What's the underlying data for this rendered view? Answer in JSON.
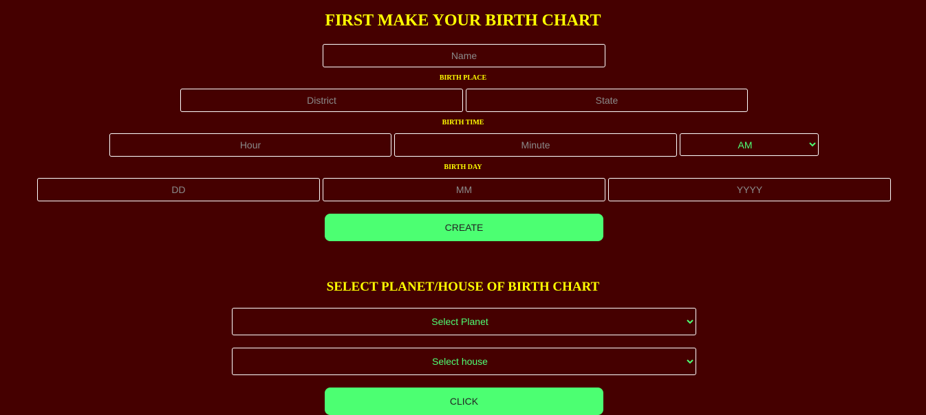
{
  "birth_chart_form": {
    "title": "FIRST MAKE YOUR BIRTH CHART",
    "name_placeholder": "Name",
    "birth_place_label": "BIRTH PLACE",
    "district_placeholder": "District",
    "state_placeholder": "State",
    "birth_time_label": "BIRTH TIME",
    "hour_placeholder": "Hour",
    "minute_placeholder": "Minute",
    "ampm_selected": "AM",
    "birth_day_label": "BIRTH DAY",
    "dd_placeholder": "DD",
    "mm_placeholder": "MM",
    "yyyy_placeholder": "YYYY",
    "create_label": "CREATE"
  },
  "planet_house_section": {
    "title": "SELECT PLANET/HOUSE OF BIRTH CHART",
    "planet_selected": "Select Planet",
    "house_selected": "Select house",
    "click_label": "CLICK"
  },
  "colors": {
    "background": "#450000",
    "heading": "#ffff00",
    "accent_green": "#4cff72"
  }
}
